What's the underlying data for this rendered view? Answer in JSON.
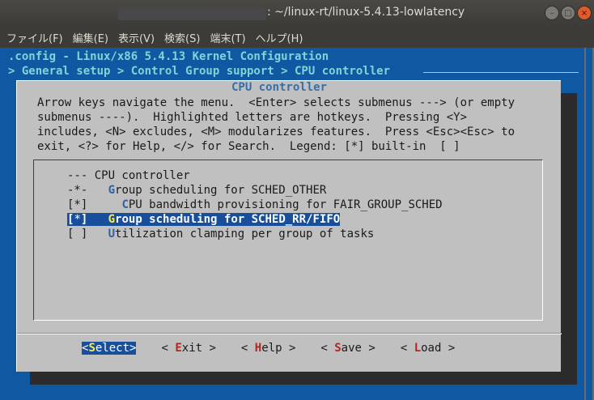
{
  "window": {
    "title": ": ~/linux-rt/linux-5.4.13-lowlatency",
    "buttons": {
      "minimize": "–",
      "maximize": "□",
      "close": "×"
    }
  },
  "menubar": {
    "items": [
      "ファイル(F)",
      "編集(E)",
      "表示(V)",
      "検索(S)",
      "端末(T)",
      "ヘルプ(H)"
    ]
  },
  "terminal": {
    "config_header": ".config - Linux/x86 5.4.13 Kernel Configuration",
    "breadcrumb": "> General setup > Control Group support > CPU controller"
  },
  "dialog": {
    "title": "CPU controller",
    "help_lines": [
      "Arrow keys navigate the menu.  <Enter> selects submenus ---> (or empty",
      "submenus ----).  Highlighted letters are hotkeys.  Pressing <Y>",
      "includes, <N> excludes, <M> modularizes features.  Press <Esc><Esc> to",
      "exit, <?> for Help, </> for Search.  Legend: [*] built-in  [ ]"
    ],
    "menu_items": [
      {
        "prefix": "--- ",
        "hotkey": "",
        "rest": "CPU controller"
      },
      {
        "prefix": "-*-   ",
        "hotkey": "G",
        "rest": "roup scheduling for SCHED_OTHER"
      },
      {
        "prefix": "[*]     ",
        "hotkey": "C",
        "rest": "PU bandwidth provisioning for FAIR_GROUP_SCHED"
      },
      {
        "prefix_open": "[",
        "prefix_cursor": "*",
        "prefix_close": "]   ",
        "hotkey": "G",
        "rest": "roup scheduling for SCHED_RR/FIFO",
        "selected": true
      },
      {
        "prefix": "[ ]   ",
        "hotkey": "U",
        "rest": "tilization clamping per group of tasks"
      }
    ],
    "buttons": [
      {
        "open": "<",
        "hotkey": "S",
        "rest": "elect",
        "close": ">",
        "active": true
      },
      {
        "open": "< ",
        "hotkey": "E",
        "rest": "xit",
        "close": " >",
        "active": false
      },
      {
        "open": "< ",
        "hotkey": "H",
        "rest": "elp",
        "close": " >",
        "active": false
      },
      {
        "open": "< ",
        "hotkey": "S",
        "rest": "ave",
        "close": " >",
        "active": false
      },
      {
        "open": "< ",
        "hotkey": "L",
        "rest": "oad",
        "close": " >",
        "active": false
      }
    ]
  },
  "colors": {
    "terminal_bg": "#0f59a2",
    "dialog_bg": "#c0c0c0",
    "selection_bg": "#174f9c",
    "hotkey_selected": "#ffe94a",
    "button_hotkey": "#b1261d"
  }
}
